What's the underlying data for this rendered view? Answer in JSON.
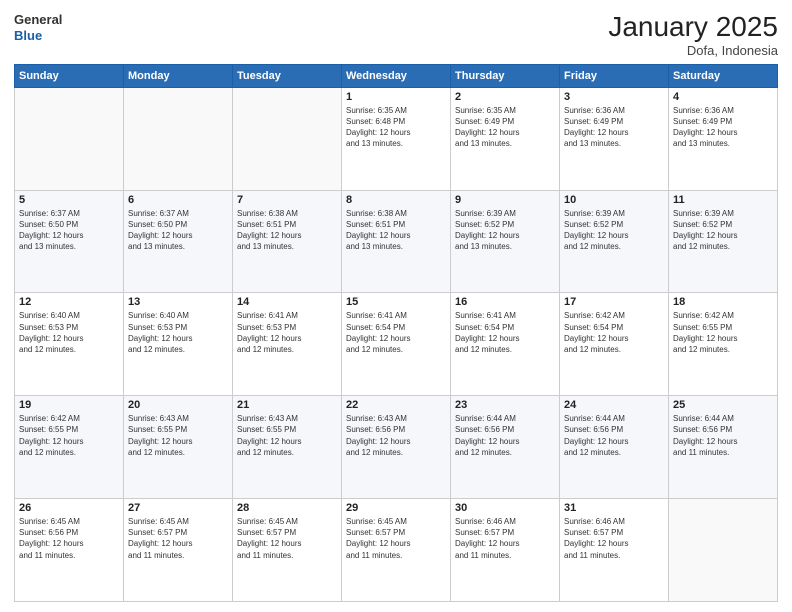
{
  "logo": {
    "line1": "General",
    "line2": "Blue"
  },
  "title": "January 2025",
  "location": "Dofa, Indonesia",
  "weekdays": [
    "Sunday",
    "Monday",
    "Tuesday",
    "Wednesday",
    "Thursday",
    "Friday",
    "Saturday"
  ],
  "weeks": [
    [
      {
        "day": "",
        "info": ""
      },
      {
        "day": "",
        "info": ""
      },
      {
        "day": "",
        "info": ""
      },
      {
        "day": "1",
        "info": "Sunrise: 6:35 AM\nSunset: 6:48 PM\nDaylight: 12 hours\nand 13 minutes."
      },
      {
        "day": "2",
        "info": "Sunrise: 6:35 AM\nSunset: 6:49 PM\nDaylight: 12 hours\nand 13 minutes."
      },
      {
        "day": "3",
        "info": "Sunrise: 6:36 AM\nSunset: 6:49 PM\nDaylight: 12 hours\nand 13 minutes."
      },
      {
        "day": "4",
        "info": "Sunrise: 6:36 AM\nSunset: 6:49 PM\nDaylight: 12 hours\nand 13 minutes."
      }
    ],
    [
      {
        "day": "5",
        "info": "Sunrise: 6:37 AM\nSunset: 6:50 PM\nDaylight: 12 hours\nand 13 minutes."
      },
      {
        "day": "6",
        "info": "Sunrise: 6:37 AM\nSunset: 6:50 PM\nDaylight: 12 hours\nand 13 minutes."
      },
      {
        "day": "7",
        "info": "Sunrise: 6:38 AM\nSunset: 6:51 PM\nDaylight: 12 hours\nand 13 minutes."
      },
      {
        "day": "8",
        "info": "Sunrise: 6:38 AM\nSunset: 6:51 PM\nDaylight: 12 hours\nand 13 minutes."
      },
      {
        "day": "9",
        "info": "Sunrise: 6:39 AM\nSunset: 6:52 PM\nDaylight: 12 hours\nand 13 minutes."
      },
      {
        "day": "10",
        "info": "Sunrise: 6:39 AM\nSunset: 6:52 PM\nDaylight: 12 hours\nand 12 minutes."
      },
      {
        "day": "11",
        "info": "Sunrise: 6:39 AM\nSunset: 6:52 PM\nDaylight: 12 hours\nand 12 minutes."
      }
    ],
    [
      {
        "day": "12",
        "info": "Sunrise: 6:40 AM\nSunset: 6:53 PM\nDaylight: 12 hours\nand 12 minutes."
      },
      {
        "day": "13",
        "info": "Sunrise: 6:40 AM\nSunset: 6:53 PM\nDaylight: 12 hours\nand 12 minutes."
      },
      {
        "day": "14",
        "info": "Sunrise: 6:41 AM\nSunset: 6:53 PM\nDaylight: 12 hours\nand 12 minutes."
      },
      {
        "day": "15",
        "info": "Sunrise: 6:41 AM\nSunset: 6:54 PM\nDaylight: 12 hours\nand 12 minutes."
      },
      {
        "day": "16",
        "info": "Sunrise: 6:41 AM\nSunset: 6:54 PM\nDaylight: 12 hours\nand 12 minutes."
      },
      {
        "day": "17",
        "info": "Sunrise: 6:42 AM\nSunset: 6:54 PM\nDaylight: 12 hours\nand 12 minutes."
      },
      {
        "day": "18",
        "info": "Sunrise: 6:42 AM\nSunset: 6:55 PM\nDaylight: 12 hours\nand 12 minutes."
      }
    ],
    [
      {
        "day": "19",
        "info": "Sunrise: 6:42 AM\nSunset: 6:55 PM\nDaylight: 12 hours\nand 12 minutes."
      },
      {
        "day": "20",
        "info": "Sunrise: 6:43 AM\nSunset: 6:55 PM\nDaylight: 12 hours\nand 12 minutes."
      },
      {
        "day": "21",
        "info": "Sunrise: 6:43 AM\nSunset: 6:55 PM\nDaylight: 12 hours\nand 12 minutes."
      },
      {
        "day": "22",
        "info": "Sunrise: 6:43 AM\nSunset: 6:56 PM\nDaylight: 12 hours\nand 12 minutes."
      },
      {
        "day": "23",
        "info": "Sunrise: 6:44 AM\nSunset: 6:56 PM\nDaylight: 12 hours\nand 12 minutes."
      },
      {
        "day": "24",
        "info": "Sunrise: 6:44 AM\nSunset: 6:56 PM\nDaylight: 12 hours\nand 12 minutes."
      },
      {
        "day": "25",
        "info": "Sunrise: 6:44 AM\nSunset: 6:56 PM\nDaylight: 12 hours\nand 11 minutes."
      }
    ],
    [
      {
        "day": "26",
        "info": "Sunrise: 6:45 AM\nSunset: 6:56 PM\nDaylight: 12 hours\nand 11 minutes."
      },
      {
        "day": "27",
        "info": "Sunrise: 6:45 AM\nSunset: 6:57 PM\nDaylight: 12 hours\nand 11 minutes."
      },
      {
        "day": "28",
        "info": "Sunrise: 6:45 AM\nSunset: 6:57 PM\nDaylight: 12 hours\nand 11 minutes."
      },
      {
        "day": "29",
        "info": "Sunrise: 6:45 AM\nSunset: 6:57 PM\nDaylight: 12 hours\nand 11 minutes."
      },
      {
        "day": "30",
        "info": "Sunrise: 6:46 AM\nSunset: 6:57 PM\nDaylight: 12 hours\nand 11 minutes."
      },
      {
        "day": "31",
        "info": "Sunrise: 6:46 AM\nSunset: 6:57 PM\nDaylight: 12 hours\nand 11 minutes."
      },
      {
        "day": "",
        "info": ""
      }
    ]
  ]
}
